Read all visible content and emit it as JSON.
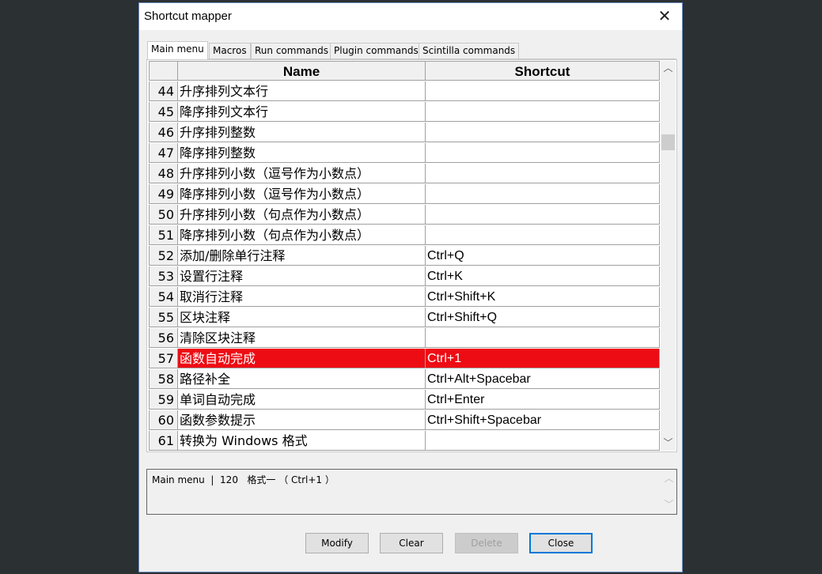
{
  "window": {
    "title": "Shortcut mapper",
    "close_glyph": "✕"
  },
  "tabs": [
    {
      "label": "Main menu",
      "active": true
    },
    {
      "label": "Macros",
      "active": false
    },
    {
      "label": "Run commands",
      "active": false
    },
    {
      "label": "Plugin commands",
      "active": false
    },
    {
      "label": "Scintilla commands",
      "active": false
    }
  ],
  "grid": {
    "columns": [
      "Name",
      "Shortcut"
    ],
    "rows": [
      {
        "num": "44",
        "name": "升序排列文本行",
        "shortcut": ""
      },
      {
        "num": "45",
        "name": "降序排列文本行",
        "shortcut": ""
      },
      {
        "num": "46",
        "name": "升序排列整数",
        "shortcut": ""
      },
      {
        "num": "47",
        "name": "降序排列整数",
        "shortcut": ""
      },
      {
        "num": "48",
        "name": "升序排列小数（逗号作为小数点）",
        "shortcut": ""
      },
      {
        "num": "49",
        "name": "降序排列小数（逗号作为小数点）",
        "shortcut": ""
      },
      {
        "num": "50",
        "name": "升序排列小数（句点作为小数点）",
        "shortcut": ""
      },
      {
        "num": "51",
        "name": "降序排列小数（句点作为小数点）",
        "shortcut": ""
      },
      {
        "num": "52",
        "name": "添加/删除单行注释",
        "shortcut": "Ctrl+Q"
      },
      {
        "num": "53",
        "name": "设置行注释",
        "shortcut": "Ctrl+K"
      },
      {
        "num": "54",
        "name": "取消行注释",
        "shortcut": "Ctrl+Shift+K"
      },
      {
        "num": "55",
        "name": "区块注释",
        "shortcut": "Ctrl+Shift+Q"
      },
      {
        "num": "56",
        "name": "清除区块注释",
        "shortcut": ""
      },
      {
        "num": "57",
        "name": "函数自动完成",
        "shortcut": "Ctrl+1",
        "selected": true
      },
      {
        "num": "58",
        "name": "路径补全",
        "shortcut": "Ctrl+Alt+Spacebar"
      },
      {
        "num": "59",
        "name": "单词自动完成",
        "shortcut": "Ctrl+Enter"
      },
      {
        "num": "60",
        "name": "函数参数提示",
        "shortcut": "Ctrl+Shift+Spacebar"
      },
      {
        "num": "61",
        "name": "转换为 Windows 格式",
        "shortcut": ""
      }
    ]
  },
  "scrollbar": {
    "up_glyph": "︿",
    "down_glyph": "﹀"
  },
  "status": {
    "text": "Main menu  |  120   格式一 （ Ctrl+1 ）"
  },
  "buttons": {
    "modify": "Modify",
    "clear": "Clear",
    "delete": "Delete",
    "close": "Close"
  },
  "colors": {
    "selection": "#ee0c14",
    "default_button_border": "#0078d7"
  }
}
